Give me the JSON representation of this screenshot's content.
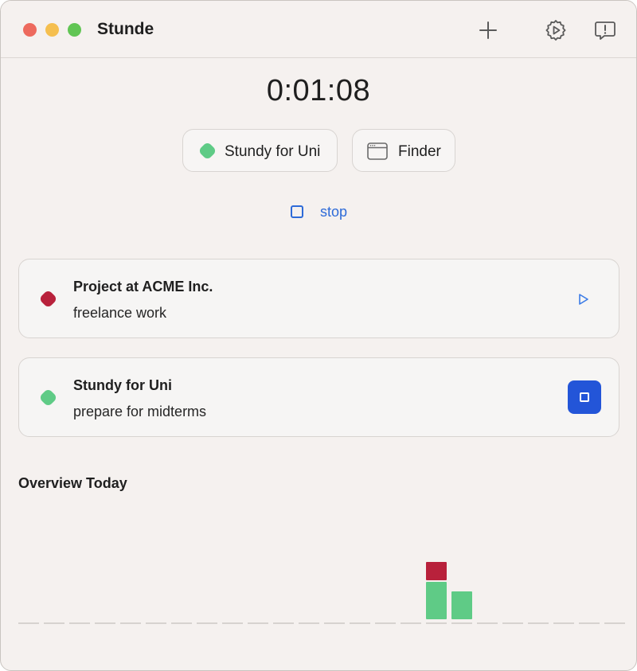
{
  "window": {
    "title": "Stunde"
  },
  "toolbar": {
    "add_icon": "plus-icon",
    "settings_icon": "gear-icon",
    "feedback_icon": "feedback-icon"
  },
  "timer": {
    "elapsed": "0:01:08"
  },
  "current": {
    "project_label": "Stundy for Uni",
    "project_color": "#5fcb86",
    "app_label": "Finder",
    "app_icon": "window-icon"
  },
  "stop_link": {
    "label": "stop"
  },
  "projects": [
    {
      "title": "Project at ACME Inc.",
      "subtitle": "freelance work",
      "color": "#b8213b",
      "action": "play",
      "action_icon": "play-icon"
    },
    {
      "title": "Stundy for Uni",
      "subtitle": "prepare for midterms",
      "color": "#5fcb86",
      "action": "stop",
      "action_icon": "stop-icon"
    }
  ],
  "overview": {
    "title": "Overview Today"
  },
  "chart_data": {
    "type": "bar",
    "stacked": true,
    "slots": 24,
    "x": [
      16,
      17
    ],
    "series": [
      {
        "color": "#5fcb86",
        "values": [
          48,
          36
        ]
      },
      {
        "color": "#b8213b",
        "values": [
          24,
          0
        ]
      }
    ],
    "grid": false
  }
}
